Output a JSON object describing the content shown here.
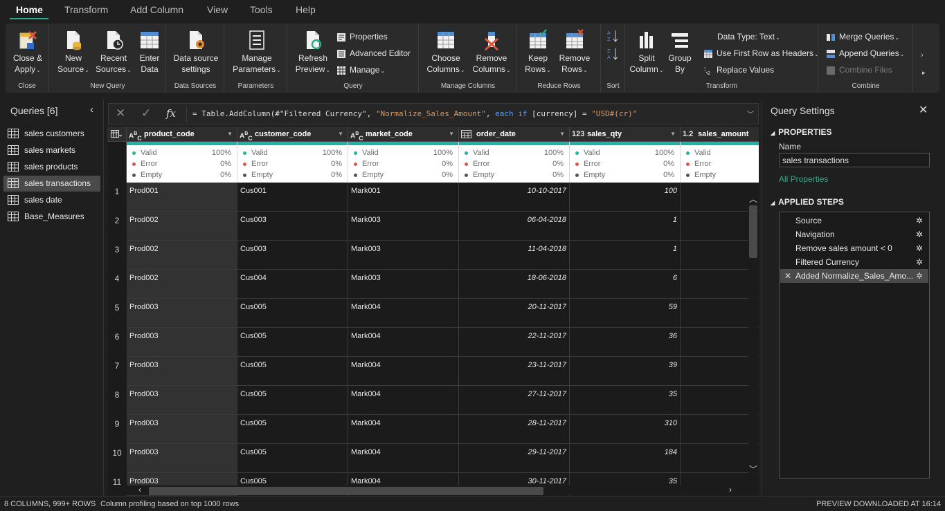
{
  "menu": {
    "tabs": [
      "Home",
      "Transform",
      "Add Column",
      "View",
      "Tools",
      "Help"
    ],
    "active": "Home"
  },
  "ribbon": {
    "close_group": {
      "label": "Close",
      "close_apply": [
        "Close &",
        "Apply"
      ]
    },
    "new_query_group": {
      "label": "New Query",
      "new_source": [
        "New",
        "Source"
      ],
      "recent_sources": [
        "Recent",
        "Sources"
      ],
      "enter_data": [
        "Enter",
        "Data"
      ]
    },
    "data_sources_group": {
      "label": "Data Sources",
      "settings": [
        "Data source",
        "settings"
      ]
    },
    "parameters_group": {
      "label": "Parameters",
      "manage": [
        "Manage",
        "Parameters"
      ]
    },
    "query_group": {
      "label": "Query",
      "refresh": [
        "Refresh",
        "Preview"
      ],
      "properties": "Properties",
      "advanced_editor": "Advanced Editor",
      "manage": "Manage"
    },
    "manage_columns_group": {
      "label": "Manage Columns",
      "choose": [
        "Choose",
        "Columns"
      ],
      "remove": [
        "Remove",
        "Columns"
      ]
    },
    "reduce_rows_group": {
      "label": "Reduce Rows",
      "keep": [
        "Keep",
        "Rows"
      ],
      "remove": [
        "Remove",
        "Rows"
      ]
    },
    "sort_group": {
      "label": "Sort"
    },
    "transform_group": {
      "label": "Transform",
      "split": [
        "Split",
        "Column"
      ],
      "group_by": [
        "Group",
        "By"
      ],
      "data_type": "Data Type: Text",
      "first_row": "Use First Row as Headers",
      "replace": "Replace Values"
    },
    "combine_group": {
      "label": "Combine",
      "merge": "Merge Queries",
      "append": "Append Queries",
      "combine_files": "Combine Files"
    }
  },
  "queries": {
    "title": "Queries [6]",
    "items": [
      "sales customers",
      "sales markets",
      "sales products",
      "sales transactions",
      "sales date",
      "Base_Measures"
    ],
    "selected": "sales transactions"
  },
  "formula": {
    "fx": "fx",
    "p1": "= Table.AddColumn(#\"Filtered Currency\", ",
    "p2": "\"Normalize_Sales_Amount\"",
    "p3": ", ",
    "p4": "each if",
    "p5": " [currency] = ",
    "p6": "\"USD#(cr)\""
  },
  "columns": [
    {
      "type": "ABC",
      "name": "product_code"
    },
    {
      "type": "ABC",
      "name": "customer_code"
    },
    {
      "type": "ABC",
      "name": "market_code"
    },
    {
      "type": "date",
      "name": "order_date"
    },
    {
      "type": "123",
      "name": "sales_qty"
    },
    {
      "type": "1.2",
      "name": "sales_amount"
    }
  ],
  "profile": {
    "labels": [
      "Valid",
      "Error",
      "Empty"
    ],
    "colors": [
      "#22b3a0",
      "#e0544d",
      "#555555"
    ],
    "values": [
      [
        "100%",
        "0%",
        "0%"
      ],
      [
        "100%",
        "0%",
        "0%"
      ],
      [
        "100%",
        "0%",
        "0%"
      ],
      [
        "100%",
        "0%",
        "0%"
      ],
      [
        "100%",
        "0%",
        "0%"
      ],
      [
        "",
        "",
        ""
      ]
    ]
  },
  "rows": [
    {
      "n": "1",
      "product": "Prod001",
      "customer": "Cus001",
      "market": "Mark001",
      "date": "10-10-2017",
      "qty": "100"
    },
    {
      "n": "2",
      "product": "Prod002",
      "customer": "Cus003",
      "market": "Mark003",
      "date": "06-04-2018",
      "qty": "1"
    },
    {
      "n": "3",
      "product": "Prod002",
      "customer": "Cus003",
      "market": "Mark003",
      "date": "11-04-2018",
      "qty": "1"
    },
    {
      "n": "4",
      "product": "Prod002",
      "customer": "Cus004",
      "market": "Mark003",
      "date": "18-06-2018",
      "qty": "6"
    },
    {
      "n": "5",
      "product": "Prod003",
      "customer": "Cus005",
      "market": "Mark004",
      "date": "20-11-2017",
      "qty": "59"
    },
    {
      "n": "6",
      "product": "Prod003",
      "customer": "Cus005",
      "market": "Mark004",
      "date": "22-11-2017",
      "qty": "36"
    },
    {
      "n": "7",
      "product": "Prod003",
      "customer": "Cus005",
      "market": "Mark004",
      "date": "23-11-2017",
      "qty": "39"
    },
    {
      "n": "8",
      "product": "Prod003",
      "customer": "Cus005",
      "market": "Mark004",
      "date": "27-11-2017",
      "qty": "35"
    },
    {
      "n": "9",
      "product": "Prod003",
      "customer": "Cus005",
      "market": "Mark004",
      "date": "28-11-2017",
      "qty": "310"
    },
    {
      "n": "10",
      "product": "Prod003",
      "customer": "Cus005",
      "market": "Mark004",
      "date": "29-11-2017",
      "qty": "184"
    },
    {
      "n": "11",
      "product": "Prod003",
      "customer": "Cus005",
      "market": "Mark004",
      "date": "30-11-2017",
      "qty": "35"
    }
  ],
  "query_settings": {
    "title": "Query Settings",
    "properties_title": "PROPERTIES",
    "name_label": "Name",
    "name_value": "sales transactions",
    "all_properties": "All Properties",
    "steps_title": "APPLIED STEPS",
    "steps": [
      "Source",
      "Navigation",
      "Remove sales amount < 0",
      "Filtered Currency",
      "Added Normalize_Sales_Amo..."
    ],
    "selected_step": 4
  },
  "status": {
    "columns_rows": "8 COLUMNS, 999+ ROWS",
    "profiling": "Column profiling based on top 1000 rows",
    "preview": "PREVIEW DOWNLOADED AT 16:14"
  },
  "colors": {
    "accent": "#2ea98f",
    "valid": "#22b3a0",
    "error": "#e0544d",
    "remove_red": "#d9553c",
    "check_green": "#2ea98f"
  }
}
